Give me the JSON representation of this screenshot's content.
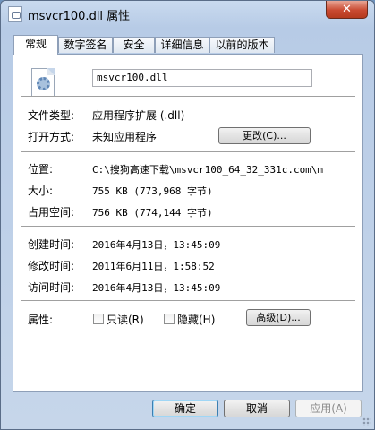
{
  "window": {
    "title": "msvcr100.dll 属性",
    "close_label": "✕"
  },
  "tabs": [
    {
      "label": "常规",
      "active": true
    },
    {
      "label": "数字签名",
      "active": false
    },
    {
      "label": "安全",
      "active": false
    },
    {
      "label": "详细信息",
      "active": false
    },
    {
      "label": "以前的版本",
      "active": false
    }
  ],
  "file": {
    "name": "msvcr100.dll",
    "icon": "dll-file-icon"
  },
  "type_section": {
    "file_type_label": "文件类型:",
    "file_type_value": "应用程序扩展 (.dll)",
    "opens_with_label": "打开方式:",
    "opens_with_value": "未知应用程序",
    "change_button": "更改(C)..."
  },
  "location_section": {
    "location_label": "位置:",
    "location_value": "C:\\搜狗高速下载\\msvcr100_64_32_331c.com\\m",
    "size_label": "大小:",
    "size_value": "755 KB (773,968 字节)",
    "size_on_disk_label": "占用空间:",
    "size_on_disk_value": "756 KB (774,144 字节)"
  },
  "dates_section": {
    "created_label": "创建时间:",
    "created_value": "2016年4月13日，13:45:09",
    "modified_label": "修改时间:",
    "modified_value": "2011年6月11日，1:58:52",
    "accessed_label": "访问时间:",
    "accessed_value": "2016年4月13日，13:45:09"
  },
  "attributes_section": {
    "label": "属性:",
    "readonly_label": "只读(R)",
    "readonly_checked": false,
    "hidden_label": "隐藏(H)",
    "hidden_checked": false,
    "advanced_button": "高级(D)..."
  },
  "buttons": {
    "ok": "确定",
    "cancel": "取消",
    "apply": "应用(A)"
  }
}
